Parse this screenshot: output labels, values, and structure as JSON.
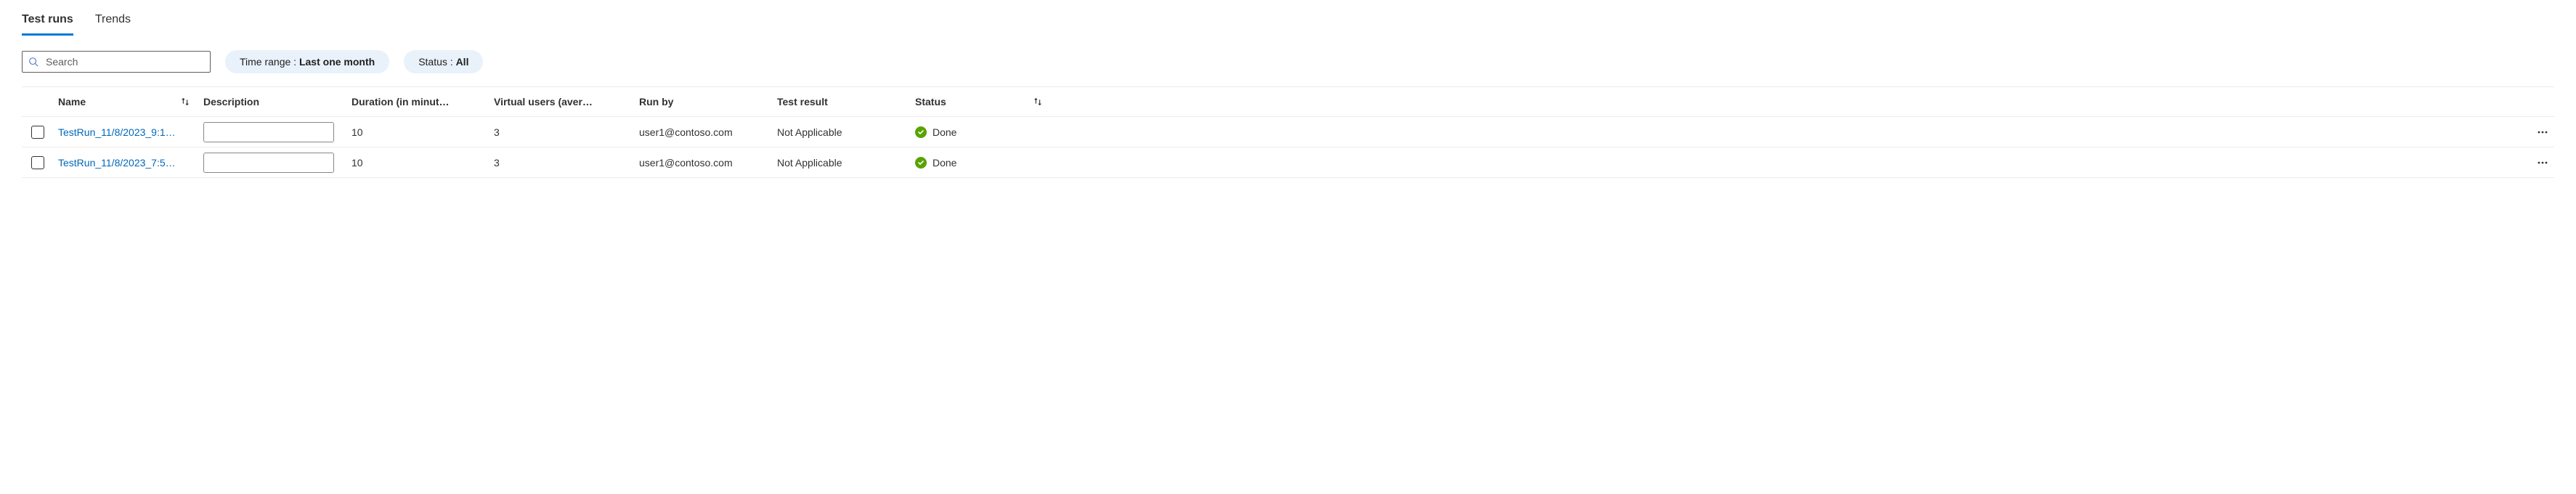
{
  "tabs": {
    "test_runs": "Test runs",
    "trends": "Trends",
    "active_index": 0
  },
  "filters": {
    "search_placeholder": "Search",
    "time_range_label": "Time range : ",
    "time_range_value": "Last one month",
    "status_label": "Status : ",
    "status_value": "All"
  },
  "table": {
    "headers": {
      "name": "Name",
      "description": "Description",
      "duration": "Duration (in minut…",
      "virtual_users": "Virtual users (aver…",
      "run_by": "Run by",
      "test_result": "Test result",
      "status": "Status"
    },
    "rows": [
      {
        "name": "TestRun_11/8/2023_9:1…",
        "description": "",
        "duration": "10",
        "virtual_users": "3",
        "run_by": "user1@contoso.com",
        "test_result": "Not Applicable",
        "status_text": "Done",
        "status_state": "success"
      },
      {
        "name": "TestRun_11/8/2023_7:5…",
        "description": "",
        "duration": "10",
        "virtual_users": "3",
        "run_by": "user1@contoso.com",
        "test_result": "Not Applicable",
        "status_text": "Done",
        "status_state": "success"
      }
    ]
  }
}
